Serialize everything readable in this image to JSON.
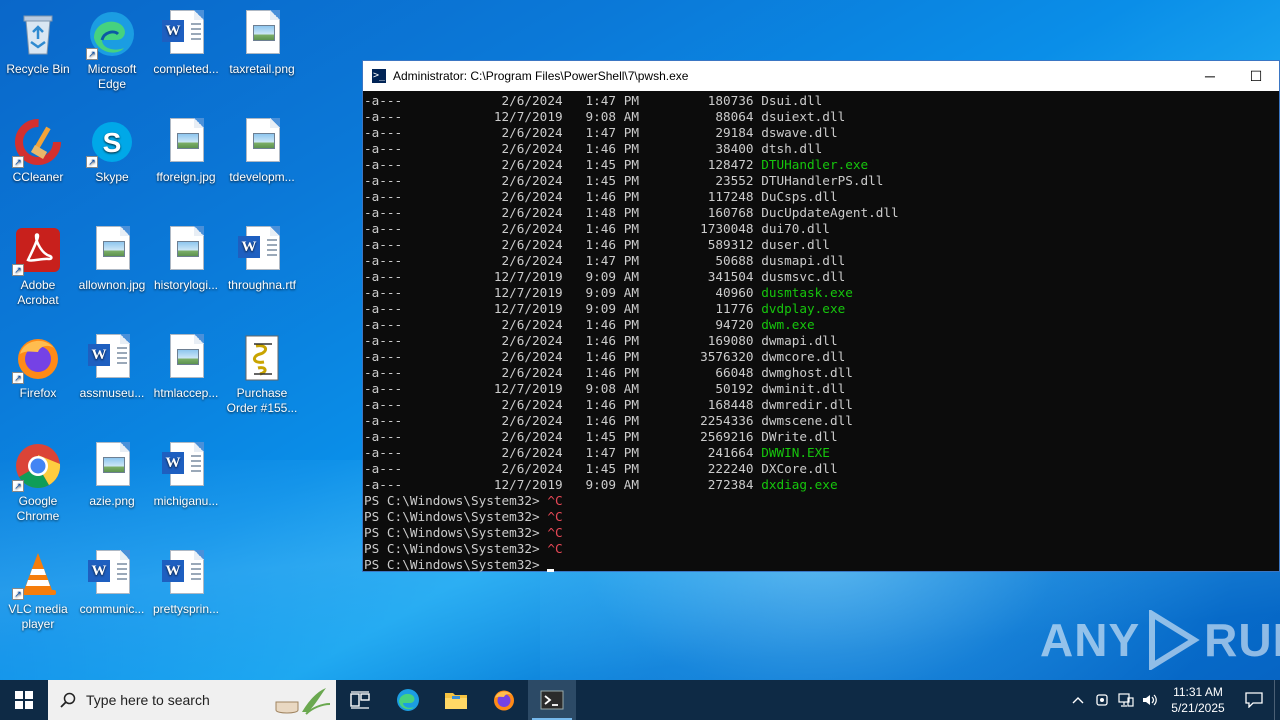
{
  "desktop": {
    "icons": [
      {
        "label": "Recycle Bin",
        "icon": "recycle-bin-icon"
      },
      {
        "label": "Microsoft Edge",
        "icon": "edge-icon"
      },
      {
        "label": "completed...",
        "icon": "word-document-icon"
      },
      {
        "label": "taxretail.png",
        "icon": "image-file-icon"
      },
      {
        "label": "CCleaner",
        "icon": "ccleaner-icon"
      },
      {
        "label": "Skype",
        "icon": "skype-icon"
      },
      {
        "label": "fforeign.jpg",
        "icon": "image-file-icon"
      },
      {
        "label": "tdevelopm...",
        "icon": "image-file-icon"
      },
      {
        "label": "Adobe Acrobat",
        "icon": "acrobat-icon"
      },
      {
        "label": "allownon.jpg",
        "icon": "image-file-icon"
      },
      {
        "label": "historylogi...",
        "icon": "image-file-icon"
      },
      {
        "label": "throughna.rtf",
        "icon": "word-document-icon"
      },
      {
        "label": "Firefox",
        "icon": "firefox-icon"
      },
      {
        "label": "assmuseu...",
        "icon": "word-document-icon"
      },
      {
        "label": "htmlaccep...",
        "icon": "image-file-icon"
      },
      {
        "label": "Purchase Order #155...",
        "icon": "script-file-icon"
      },
      {
        "label": "Google Chrome",
        "icon": "chrome-icon"
      },
      {
        "label": "azie.png",
        "icon": "image-file-icon"
      },
      {
        "label": "michiganu...",
        "icon": "word-document-icon"
      },
      {
        "label": "VLC media player",
        "icon": "vlc-icon"
      },
      {
        "label": "communic...",
        "icon": "word-document-icon"
      },
      {
        "label": "prettysprin...",
        "icon": "word-document-icon"
      }
    ]
  },
  "terminal": {
    "title": "Administrator: C:\\Program Files\\PowerShell\\7\\pwsh.exe",
    "minimize": "─",
    "maximize": "☐",
    "lines": [
      {
        "mode": "-a---",
        "date": "2/6/2024",
        "time": "1:47 PM",
        "size": "180736",
        "name": "Dsui.dll",
        "exe": false
      },
      {
        "mode": "-a---",
        "date": "12/7/2019",
        "time": "9:08 AM",
        "size": "88064",
        "name": "dsuiext.dll",
        "exe": false
      },
      {
        "mode": "-a---",
        "date": "2/6/2024",
        "time": "1:47 PM",
        "size": "29184",
        "name": "dswave.dll",
        "exe": false
      },
      {
        "mode": "-a---",
        "date": "2/6/2024",
        "time": "1:46 PM",
        "size": "38400",
        "name": "dtsh.dll",
        "exe": false
      },
      {
        "mode": "-a---",
        "date": "2/6/2024",
        "time": "1:45 PM",
        "size": "128472",
        "name": "DTUHandler.exe",
        "exe": true
      },
      {
        "mode": "-a---",
        "date": "2/6/2024",
        "time": "1:45 PM",
        "size": "23552",
        "name": "DTUHandlerPS.dll",
        "exe": false
      },
      {
        "mode": "-a---",
        "date": "2/6/2024",
        "time": "1:46 PM",
        "size": "117248",
        "name": "DuCsps.dll",
        "exe": false
      },
      {
        "mode": "-a---",
        "date": "2/6/2024",
        "time": "1:48 PM",
        "size": "160768",
        "name": "DucUpdateAgent.dll",
        "exe": false
      },
      {
        "mode": "-a---",
        "date": "2/6/2024",
        "time": "1:46 PM",
        "size": "1730048",
        "name": "dui70.dll",
        "exe": false
      },
      {
        "mode": "-a---",
        "date": "2/6/2024",
        "time": "1:46 PM",
        "size": "589312",
        "name": "duser.dll",
        "exe": false
      },
      {
        "mode": "-a---",
        "date": "2/6/2024",
        "time": "1:47 PM",
        "size": "50688",
        "name": "dusmapi.dll",
        "exe": false
      },
      {
        "mode": "-a---",
        "date": "12/7/2019",
        "time": "9:09 AM",
        "size": "341504",
        "name": "dusmsvc.dll",
        "exe": false
      },
      {
        "mode": "-a---",
        "date": "12/7/2019",
        "time": "9:09 AM",
        "size": "40960",
        "name": "dusmtask.exe",
        "exe": true
      },
      {
        "mode": "-a---",
        "date": "12/7/2019",
        "time": "9:09 AM",
        "size": "11776",
        "name": "dvdplay.exe",
        "exe": true
      },
      {
        "mode": "-a---",
        "date": "2/6/2024",
        "time": "1:46 PM",
        "size": "94720",
        "name": "dwm.exe",
        "exe": true
      },
      {
        "mode": "-a---",
        "date": "2/6/2024",
        "time": "1:46 PM",
        "size": "169080",
        "name": "dwmapi.dll",
        "exe": false
      },
      {
        "mode": "-a---",
        "date": "2/6/2024",
        "time": "1:46 PM",
        "size": "3576320",
        "name": "dwmcore.dll",
        "exe": false
      },
      {
        "mode": "-a---",
        "date": "2/6/2024",
        "time": "1:46 PM",
        "size": "66048",
        "name": "dwmghost.dll",
        "exe": false
      },
      {
        "mode": "-a---",
        "date": "12/7/2019",
        "time": "9:08 AM",
        "size": "50192",
        "name": "dwminit.dll",
        "exe": false
      },
      {
        "mode": "-a---",
        "date": "2/6/2024",
        "time": "1:46 PM",
        "size": "168448",
        "name": "dwmredir.dll",
        "exe": false
      },
      {
        "mode": "-a---",
        "date": "2/6/2024",
        "time": "1:46 PM",
        "size": "2254336",
        "name": "dwmscene.dll",
        "exe": false
      },
      {
        "mode": "-a---",
        "date": "2/6/2024",
        "time": "1:45 PM",
        "size": "2569216",
        "name": "DWrite.dll",
        "exe": false
      },
      {
        "mode": "-a---",
        "date": "2/6/2024",
        "time": "1:47 PM",
        "size": "241664",
        "name": "DWWIN.EXE",
        "exe": true
      },
      {
        "mode": "-a---",
        "date": "2/6/2024",
        "time": "1:45 PM",
        "size": "222240",
        "name": "DXCore.dll",
        "exe": false
      },
      {
        "mode": "-a---",
        "date": "12/7/2019",
        "time": "9:09 AM",
        "size": "272384",
        "name": "dxdiag.exe",
        "exe": true
      }
    ],
    "prompts": [
      {
        "prompt": "PS C:\\Windows\\System32> ",
        "input": "^C"
      },
      {
        "prompt": "PS C:\\Windows\\System32> ",
        "input": "^C"
      },
      {
        "prompt": "PS C:\\Windows\\System32> ",
        "input": "^C"
      },
      {
        "prompt": "PS C:\\Windows\\System32> ",
        "input": "^C"
      },
      {
        "prompt": "PS C:\\Windows\\System32> ",
        "input": ""
      }
    ]
  },
  "watermark": {
    "left": "ANY",
    "right": "RUN"
  },
  "taskbar": {
    "search_placeholder": "Type here to search",
    "apps": [
      "task-view-icon",
      "edge-icon",
      "file-explorer-icon",
      "firefox-icon",
      "powershell-icon"
    ],
    "clock_time": "11:31 AM",
    "clock_date": "5/21/2025"
  },
  "colors": {
    "exe_green": "#16c60c",
    "ctrl_c_red": "#e74856",
    "terminal_bg": "#0c0c0c",
    "taskbar_bg": "#0e2a45"
  }
}
